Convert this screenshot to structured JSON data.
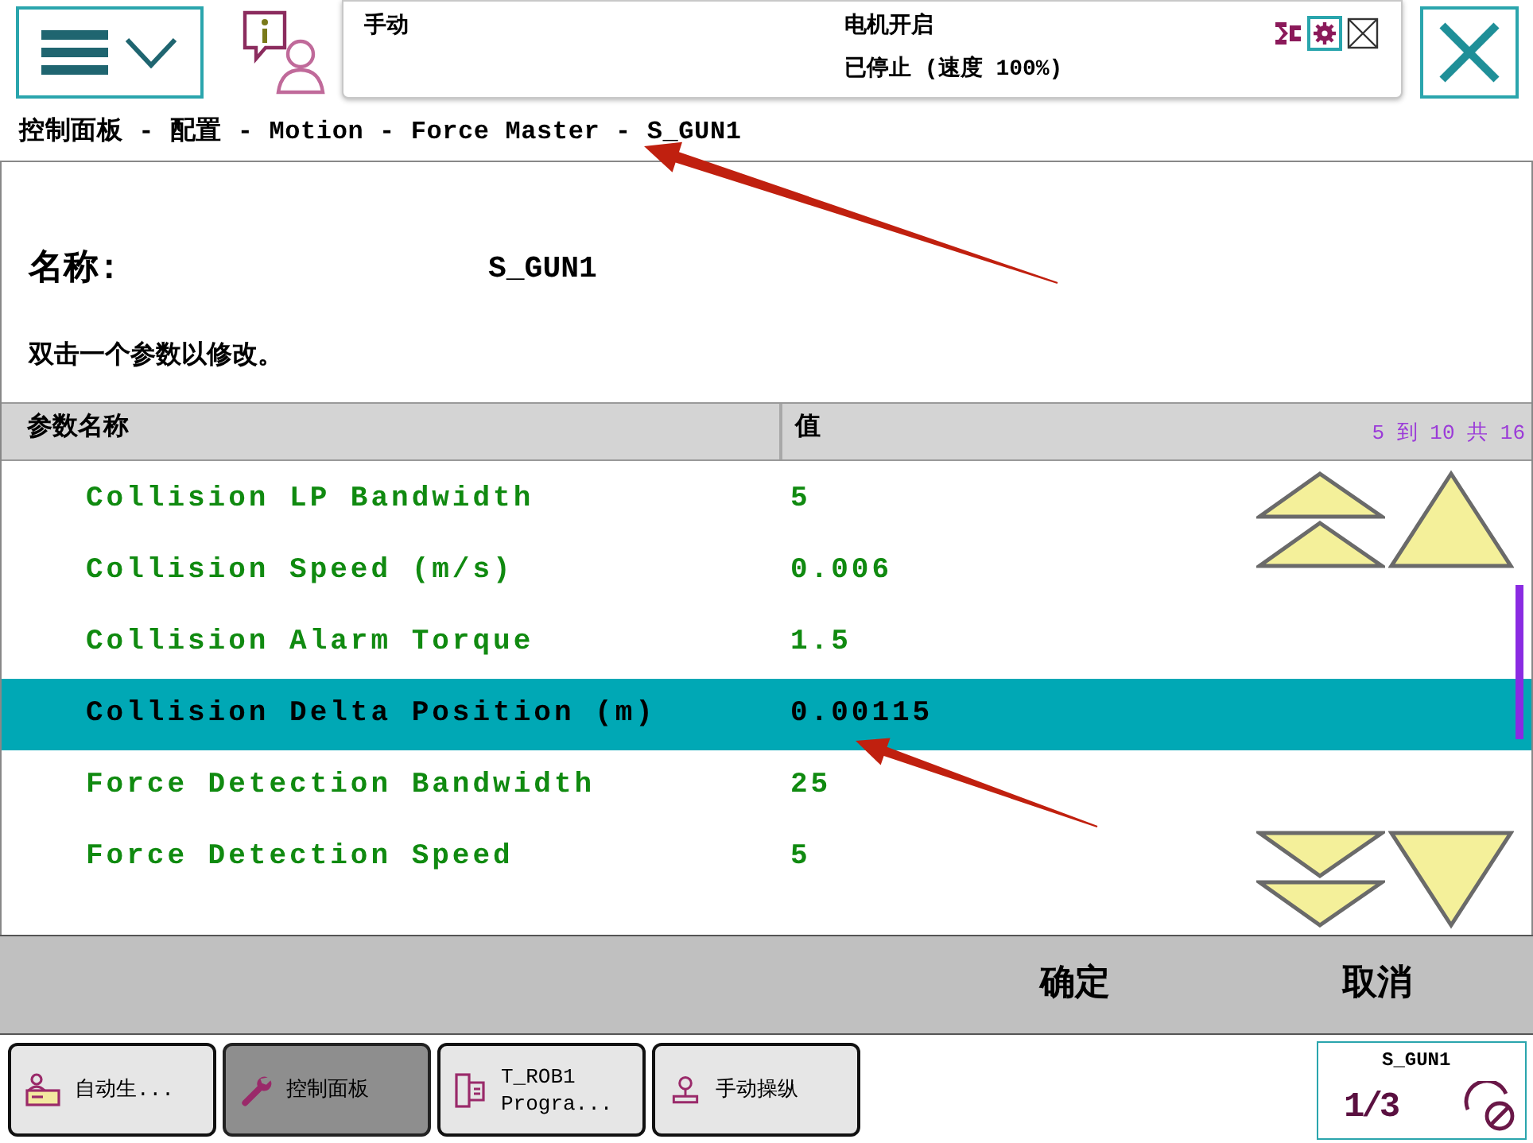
{
  "status_panel": {
    "mode": "手动",
    "motor": "电机开启",
    "state": "已停止 (速度 100%)"
  },
  "breadcrumb": "控制面板 - 配置 - Motion - Force Master - S_GUN1",
  "name": {
    "label": "名称:",
    "value": "S_GUN1"
  },
  "instruction": "双击一个参数以修改。",
  "table": {
    "columns": [
      "参数名称",
      "值"
    ],
    "range": "5 到 10 共 16",
    "rows": [
      {
        "name": "Collision LP Bandwidth",
        "value": "5",
        "selected": false
      },
      {
        "name": "Collision Speed (m/s)",
        "value": "0.006",
        "selected": false
      },
      {
        "name": "Collision Alarm Torque",
        "value": "1.5",
        "selected": false
      },
      {
        "name": "Collision Delta Position (m)",
        "value": "0.00115",
        "selected": true
      },
      {
        "name": "Force Detection Bandwidth",
        "value": "25",
        "selected": false
      },
      {
        "name": "Force Detection Speed",
        "value": "5",
        "selected": false
      }
    ]
  },
  "actions": [
    "确定",
    "取消"
  ],
  "taskbar": [
    {
      "label": "自动生...",
      "selected": false
    },
    {
      "label": "控制面板",
      "selected": true
    },
    {
      "label": "T_ROB1\nProgra...",
      "selected": false
    },
    {
      "label": "手动操纵",
      "selected": false
    }
  ],
  "task_status": {
    "title": "S_GUN1",
    "fraction": "1/3"
  }
}
